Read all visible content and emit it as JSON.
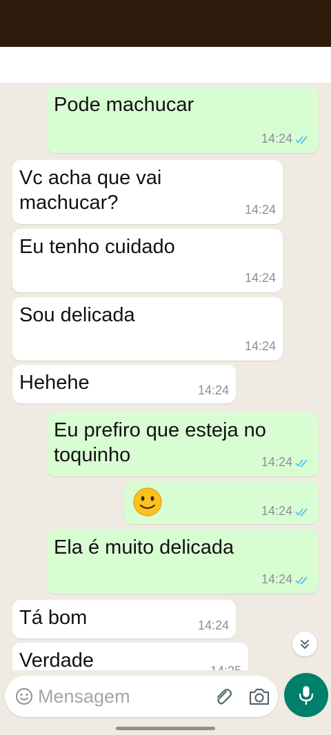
{
  "colors": {
    "status_bar": "#2e1a0b",
    "chat_background": "#efeae2",
    "incoming_bubble": "#ffffff",
    "outgoing_bubble": "#d9fdd3",
    "read_ticks": "#53bdeb",
    "mic_button": "#00806b"
  },
  "messages": [
    {
      "direction": "outgoing",
      "text": "Pode machucar",
      "time": "14:24",
      "status": "read"
    },
    {
      "direction": "incoming",
      "text": "Vc acha que vai\nmachucar?",
      "time": "14:24"
    },
    {
      "direction": "incoming",
      "text": "Eu tenho cuidado",
      "time": "14:24"
    },
    {
      "direction": "incoming",
      "text": "Sou delicada",
      "time": "14:24"
    },
    {
      "direction": "incoming",
      "text": "Hehehe",
      "time": "14:24"
    },
    {
      "direction": "outgoing",
      "text": "Eu prefiro que esteja no\ntoquinho",
      "time": "14:24",
      "status": "read"
    },
    {
      "direction": "outgoing",
      "emoji": "slightly-smiling-face-emoji",
      "time": "14:24",
      "status": "read"
    },
    {
      "direction": "outgoing",
      "text": "Ela é muito delicada",
      "time": "14:24",
      "status": "read"
    },
    {
      "direction": "incoming",
      "text": "Tá bom",
      "time": "14:24"
    },
    {
      "direction": "incoming",
      "text": "Verdade",
      "time": "14:25"
    }
  ],
  "composer": {
    "placeholder": "Mensagem",
    "emoji_icon": "emoji-icon",
    "attach_icon": "paperclip-icon",
    "camera_icon": "camera-icon",
    "mic_icon": "mic-icon"
  },
  "scroll_button_icon": "double-chevron-down-icon"
}
